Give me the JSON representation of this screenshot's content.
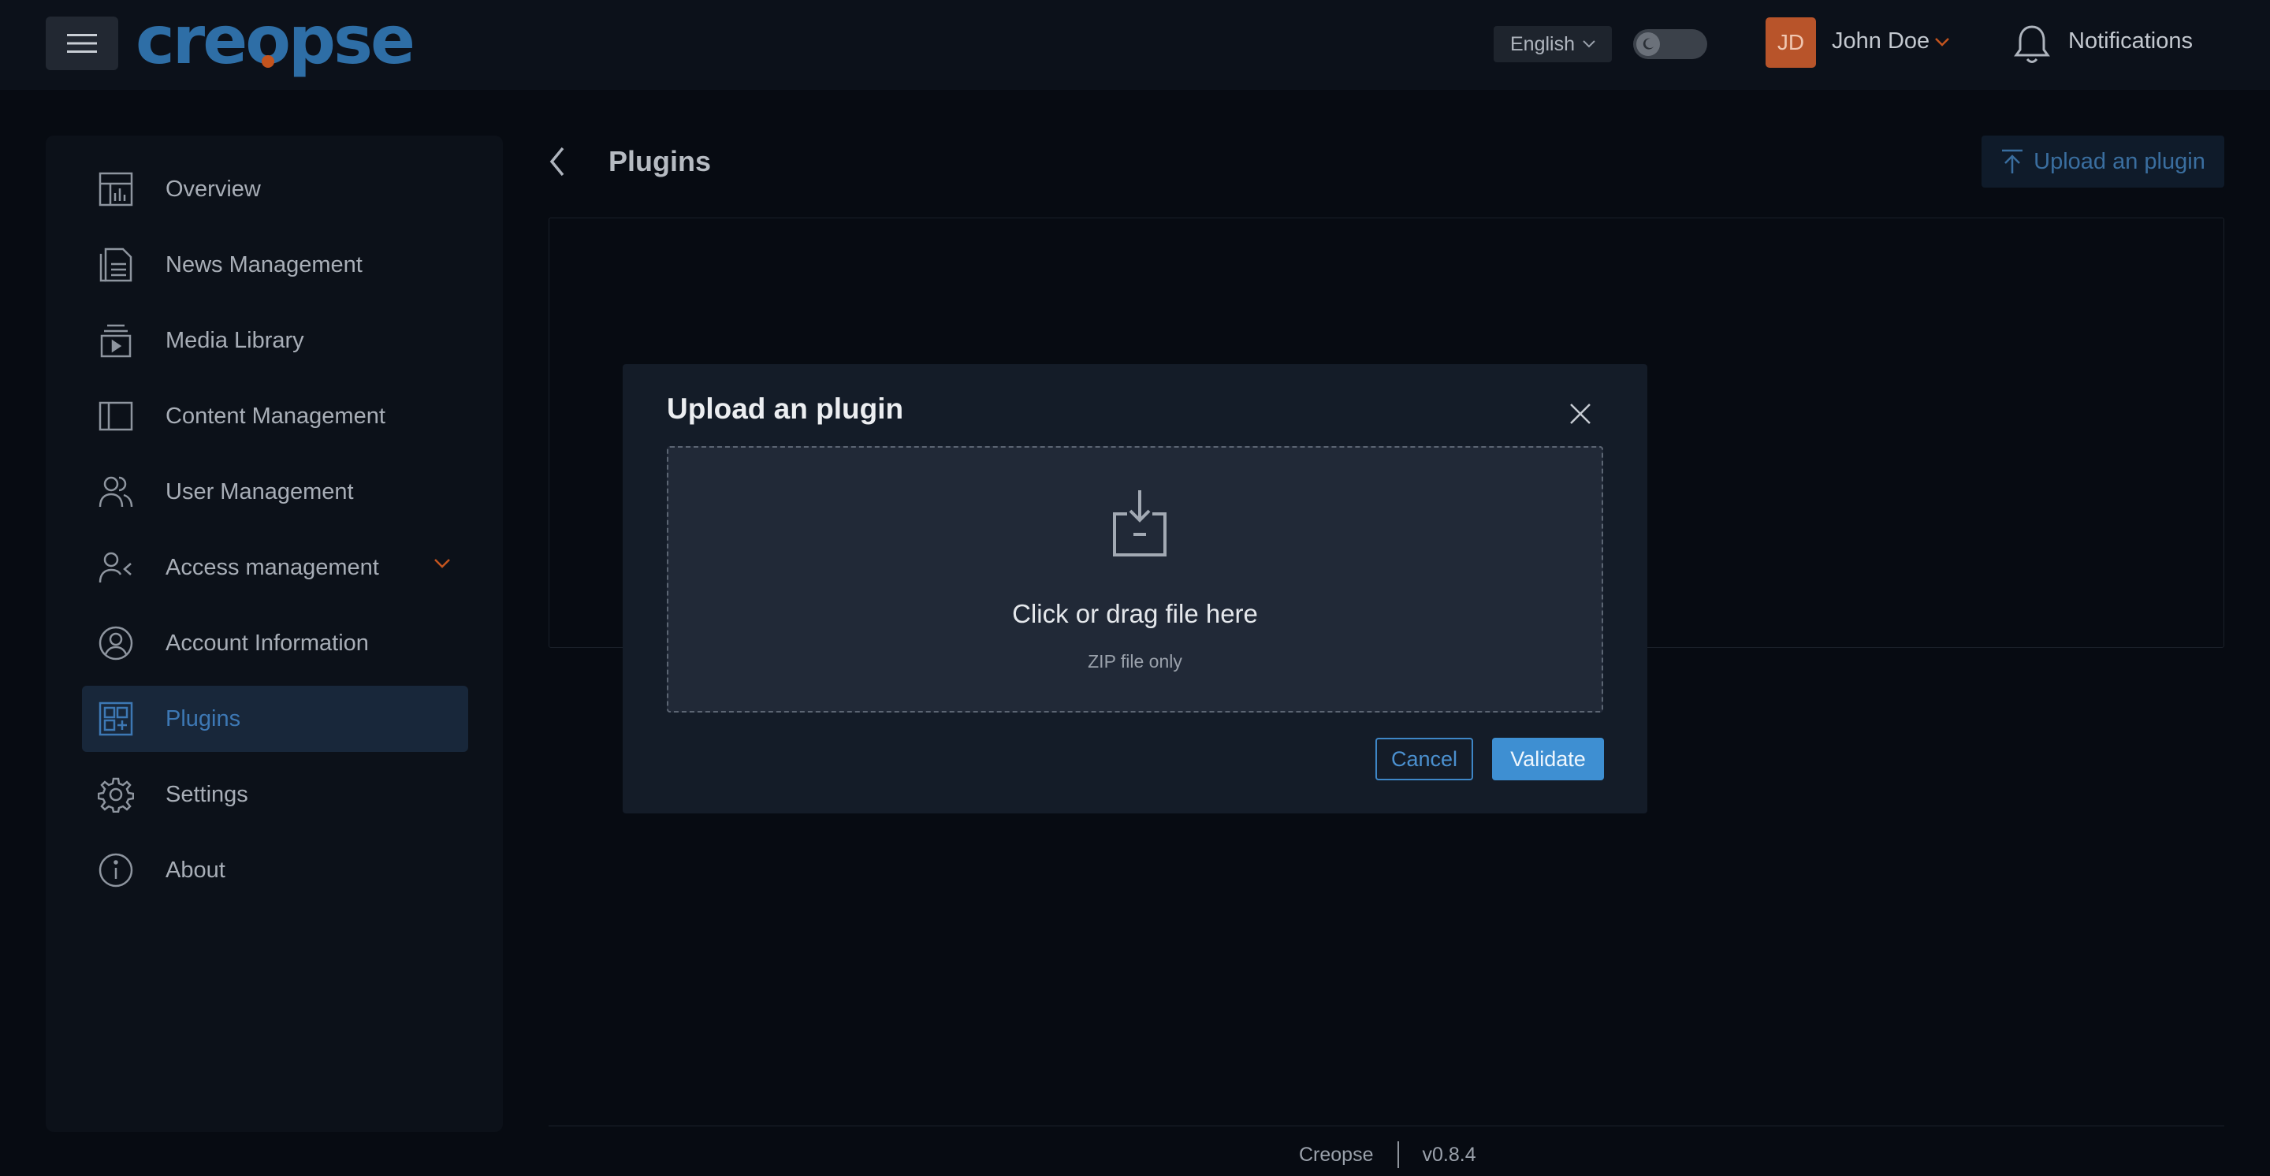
{
  "brand": {
    "logo_text": "creopse",
    "accent": "#2e6ea6",
    "dot_color": "#c4541e"
  },
  "header": {
    "language": "English",
    "user_initials": "JD",
    "user_name": "John Doe",
    "notifications_label": "Notifications"
  },
  "sidebar": {
    "items": [
      {
        "label": "Overview",
        "icon": "dashboard-icon"
      },
      {
        "label": "News Management",
        "icon": "newspaper-icon"
      },
      {
        "label": "Media Library",
        "icon": "media-library-icon"
      },
      {
        "label": "Content Management",
        "icon": "layout-icon"
      },
      {
        "label": "User Management",
        "icon": "users-icon"
      },
      {
        "label": "Access management",
        "icon": "user-access-icon"
      },
      {
        "label": "Account Information",
        "icon": "user-circle-icon"
      },
      {
        "label": "Plugins",
        "icon": "plugins-icon",
        "active": true
      },
      {
        "label": "Settings",
        "icon": "gear-icon"
      },
      {
        "label": "About",
        "icon": "info-icon"
      }
    ]
  },
  "page": {
    "title": "Plugins",
    "upload_button": "Upload an plugin"
  },
  "modal": {
    "title": "Upload an plugin",
    "drop_text": "Click or drag file here",
    "drop_hint": "ZIP file only",
    "cancel_label": "Cancel",
    "validate_label": "Validate"
  },
  "footer": {
    "app_name": "Creopse",
    "version": "v0.8.4"
  }
}
